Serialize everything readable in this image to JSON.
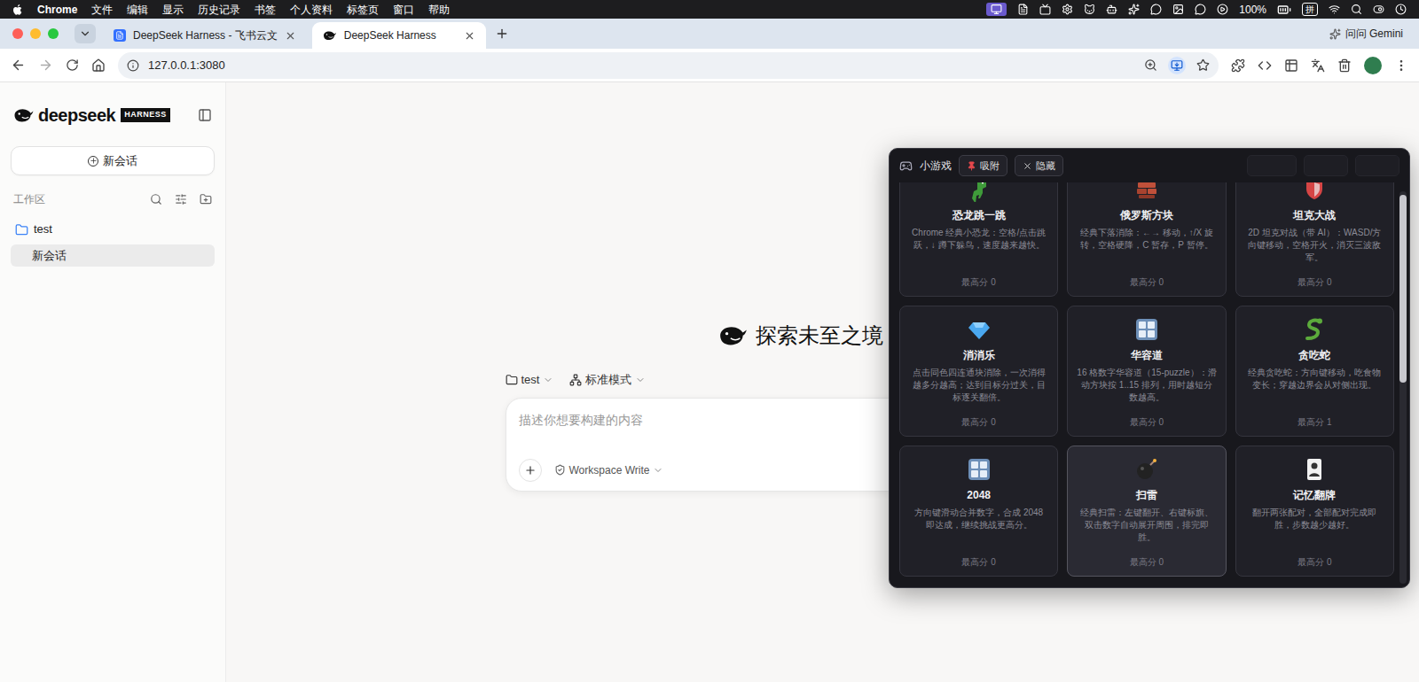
{
  "menu_bar": {
    "app": "Chrome",
    "items": [
      "文件",
      "编辑",
      "显示",
      "历史记录",
      "书签",
      "个人资料",
      "标签页",
      "窗口",
      "帮助"
    ],
    "battery": "100%",
    "input_method": "拼"
  },
  "browser": {
    "tabs": [
      {
        "label": "DeepSeek Harness - 飞书云文",
        "selected": false
      },
      {
        "label": "DeepSeek Harness",
        "selected": true
      }
    ],
    "address": "127.0.0.1:3080",
    "gemini": "问问 Gemini"
  },
  "sidebar": {
    "logo": "deepseek",
    "badge": "HARNESS",
    "new_chat": "新会话",
    "section": "工作区",
    "folders": [
      {
        "name": "test",
        "expanded": true,
        "items": [
          {
            "label": "新会话",
            "selected": true
          }
        ]
      }
    ]
  },
  "main": {
    "heading": "探索未至之境",
    "chips": [
      "test",
      "标准模式"
    ],
    "input": {
      "placeholder": "描述你想要构建的内容"
    },
    "permission": "Workspace Write"
  },
  "games_panel": {
    "title": "小游戏",
    "buttons": [
      "吸附",
      "隐藏"
    ],
    "games": [
      {
        "name": "恐龙跳一跳",
        "description": "Chrome 经典小恐龙：空格/点击跳跃，↓ 蹲下躲鸟，速度越来越快。",
        "best": "最高分 0",
        "hovered": false
      },
      {
        "name": "俄罗斯方块",
        "description": "经典下落消除：←→ 移动，↑/X 旋转，空格硬降，C 暂存，P 暂停。",
        "best": "最高分 0",
        "hovered": false
      },
      {
        "name": "坦克大战",
        "description": "2D 坦克对战（带 AI）：WASD/方向键移动，空格开火，消灭三波敌军。",
        "best": "最高分 0",
        "hovered": false
      },
      {
        "name": "消消乐",
        "description": "点击同色四连通块消除，一次消得越多分越高；达到目标分过关，目标逐关翻倍。",
        "best": "最高分 0",
        "hovered": false
      },
      {
        "name": "华容道",
        "description": "16 格数字华容道（15-puzzle）：滑动方块按 1..15 排列，用时越短分数越高。",
        "best": "最高分 0",
        "hovered": false
      },
      {
        "name": "贪吃蛇",
        "description": "经典贪吃蛇：方向键移动，吃食物变长；穿越边界会从对侧出现。",
        "best": "最高分 1",
        "hovered": false
      },
      {
        "name": "2048",
        "description": "方向键滑动合并数字，合成 2048 即达成，继续挑战更高分。",
        "best": "最高分 0",
        "hovered": false
      },
      {
        "name": "扫雷",
        "description": "经典扫雷：左键翻开、右键标旗、双击数字自动展开周围，排完即胜。",
        "best": "最高分 0",
        "hovered": true
      },
      {
        "name": "记忆翻牌",
        "description": "翻开两张配对，全部配对完成即胜，步数越少越好。",
        "best": "最高分 0",
        "hovered": false
      }
    ]
  }
}
